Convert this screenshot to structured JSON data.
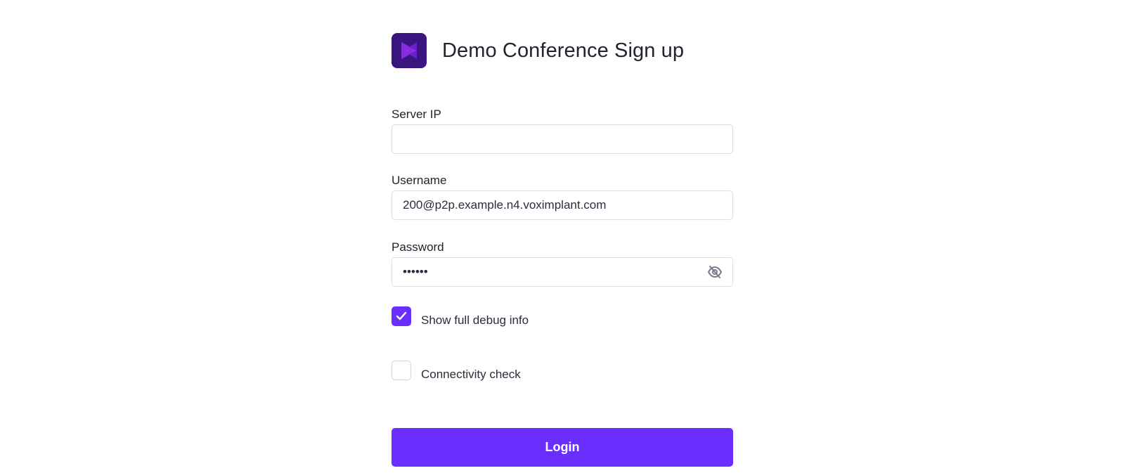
{
  "header": {
    "logo_icon": "voximplant-logo-icon",
    "title": "Demo Conference Sign up"
  },
  "form": {
    "server_ip": {
      "label": "Server IP",
      "value": ""
    },
    "username": {
      "label": "Username",
      "value": "200@p2p.example.n4.voximplant.com"
    },
    "password": {
      "label": "Password",
      "value": "••••••",
      "toggle_icon": "eye-off-icon"
    },
    "debug_checkbox": {
      "label": "Show full debug info",
      "checked": true
    },
    "connectivity_checkbox": {
      "label": "Connectivity check",
      "checked": false
    },
    "login_button": {
      "label": "Login"
    }
  },
  "colors": {
    "accent": "#6a2fff",
    "logo_bg": "#3a1580",
    "logo_mark": "#8a2be2"
  }
}
